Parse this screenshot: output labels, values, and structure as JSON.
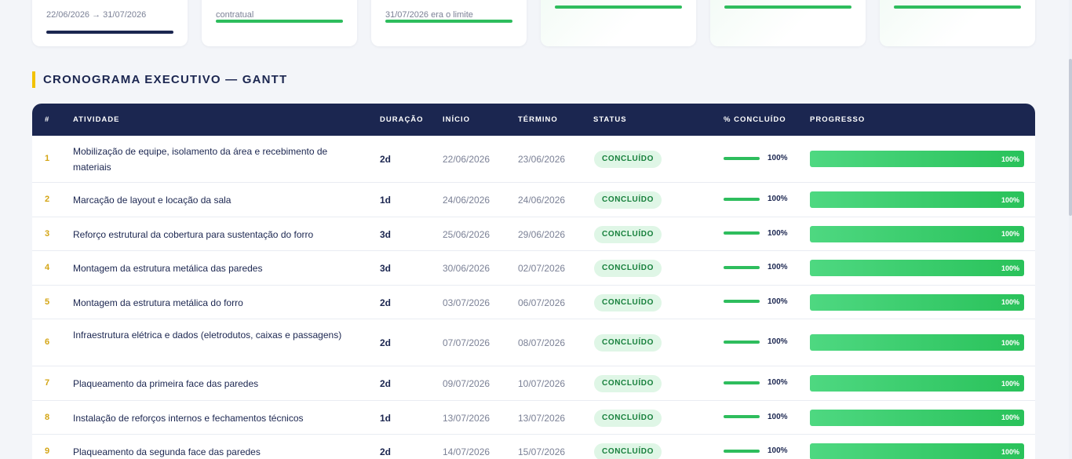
{
  "cards": [
    {
      "sub": "22/06/2026 → 31/07/2026",
      "bar": "dark"
    },
    {
      "sub": "contratual",
      "bar": "green"
    },
    {
      "sub": "31/07/2026 era o limite",
      "bar": "green"
    },
    {
      "sub": "",
      "bar": "green"
    },
    {
      "sub": "",
      "bar": "green"
    },
    {
      "sub": "",
      "bar": "green"
    }
  ],
  "section": {
    "title": "CRONOGRAMA EXECUTIVO — GANTT"
  },
  "table": {
    "headers": {
      "num": "#",
      "activity": "ATIVIDADE",
      "duration": "DURAÇÃO",
      "start": "INÍCIO",
      "end": "TÉRMINO",
      "status": "STATUS",
      "pct": "% CONCLUÍDO",
      "progress": "PROGRESSO"
    },
    "rows": [
      {
        "num": "1",
        "activity": "Mobilização de equipe, isolamento da área e recebimento de materiais",
        "duration": "2d",
        "start": "22/06/2026",
        "end": "23/06/2026",
        "status": "CONCLUÍDO",
        "pct": "100%",
        "progress": 1.0
      },
      {
        "num": "2",
        "activity": "Marcação de layout e locação da sala",
        "duration": "1d",
        "start": "24/06/2026",
        "end": "24/06/2026",
        "status": "CONCLUÍDO",
        "pct": "100%",
        "progress": 1.0
      },
      {
        "num": "3",
        "activity": "Reforço estrutural da cobertura para sustentação do forro",
        "duration": "3d",
        "start": "25/06/2026",
        "end": "29/06/2026",
        "status": "CONCLUÍDO",
        "pct": "100%",
        "progress": 1.0
      },
      {
        "num": "4",
        "activity": "Montagem da estrutura metálica das paredes",
        "duration": "3d",
        "start": "30/06/2026",
        "end": "02/07/2026",
        "status": "CONCLUÍDO",
        "pct": "100%",
        "progress": 1.0
      },
      {
        "num": "5",
        "activity": "Montagem da estrutura metálica do forro",
        "duration": "2d",
        "start": "03/07/2026",
        "end": "06/07/2026",
        "status": "CONCLUÍDO",
        "pct": "100%",
        "progress": 1.0
      },
      {
        "num": "6",
        "activity": "Infraestrutura elétrica e dados (eletrodutos, caixas e passagens)",
        "duration": "2d",
        "start": "07/07/2026",
        "end": "08/07/2026",
        "status": "CONCLUÍDO",
        "pct": "100%",
        "progress": 1.0
      },
      {
        "num": "7",
        "activity": "Plaqueamento da primeira face das paredes",
        "duration": "2d",
        "start": "09/07/2026",
        "end": "10/07/2026",
        "status": "CONCLUÍDO",
        "pct": "100%",
        "progress": 1.0
      },
      {
        "num": "8",
        "activity": "Instalação de reforços internos e fechamentos técnicos",
        "duration": "1d",
        "start": "13/07/2026",
        "end": "13/07/2026",
        "status": "CONCLUÍDO",
        "pct": "100%",
        "progress": 1.0
      },
      {
        "num": "9",
        "activity": "Plaqueamento da segunda face das paredes",
        "duration": "2d",
        "start": "14/07/2026",
        "end": "15/07/2026",
        "status": "CONCLUÍDO",
        "pct": "100%",
        "progress": 1.0
      }
    ]
  },
  "colors": {
    "navy": "#1b2650",
    "accent_yellow": "#f2c200",
    "success_green": "#2ebd5d",
    "badge_bg": "#dff6e6",
    "badge_text": "#17803c"
  }
}
